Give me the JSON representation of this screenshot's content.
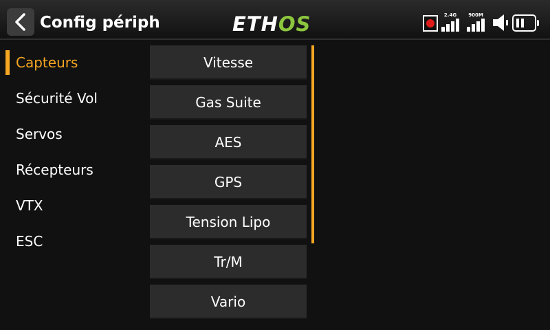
{
  "header": {
    "title": "Config périph",
    "logo_left": "ETH",
    "logo_right": "OS",
    "rssi_1_label": "2.4G",
    "rssi_2_label": "900M"
  },
  "icons": {
    "back": "chevron-left-icon",
    "record": "record-icon",
    "speaker": "speaker-icon",
    "battery": "battery-icon"
  },
  "colors": {
    "accent": "#f5a623",
    "logo_green": "#8cc63f",
    "record_red": "#e01b1b",
    "button_bg": "#2c2c2c"
  },
  "sidebar": {
    "items": [
      {
        "label": "Capteurs"
      },
      {
        "label": "Sécurité Vol"
      },
      {
        "label": "Servos"
      },
      {
        "label": "Récepteurs"
      },
      {
        "label": "VTX"
      },
      {
        "label": "ESC"
      }
    ],
    "selected": "Capteurs"
  },
  "list": {
    "items": [
      {
        "label": "Vitesse"
      },
      {
        "label": "Gas Suite"
      },
      {
        "label": "AES"
      },
      {
        "label": "GPS"
      },
      {
        "label": "Tension Lipo"
      },
      {
        "label": "Tr/M"
      },
      {
        "label": "Vario"
      }
    ]
  }
}
